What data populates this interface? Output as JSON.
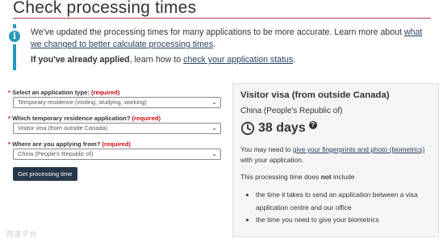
{
  "page": {
    "title": "Check processing times"
  },
  "notice": {
    "text_before": "We've updated the processing times for many applications to be more accurate. Learn more about ",
    "link1": "what we changed to better calculate processing times",
    "text_after": ".",
    "line2_bold": "If you've already applied",
    "line2_mid": ", learn how to ",
    "link2": "check your application status",
    "line2_end": "."
  },
  "form": {
    "required_marker": "*",
    "q1": {
      "label": "Select an application type: ",
      "required": "(required)",
      "value": "Temporary residence (visiting, studying, working)"
    },
    "q2": {
      "label": "Which temporary residence application? ",
      "required": "(required)",
      "value": "Visitor visa (from outside Canada)"
    },
    "q3": {
      "label": "Where are you applying from? ",
      "required": "(required)",
      "value": "China (People's Republic of)"
    },
    "button": "Get processing time"
  },
  "result": {
    "title": "Visitor visa (from outside Canada)",
    "country": "China (People's Republic of)",
    "days": "38 days",
    "biometrics_pre": "You may need to ",
    "biometrics_link": "give your fingerprints and photo (biometrics)",
    "biometrics_post": " with your application.",
    "not_include_pre": "This processing time does ",
    "not_include_bold": "not",
    "not_include_post": " include",
    "list": [
      "the time it takes to send an application between a visa application centre and our office",
      "the time you need to give your biometrics"
    ]
  },
  "watermark": "简度平台"
}
